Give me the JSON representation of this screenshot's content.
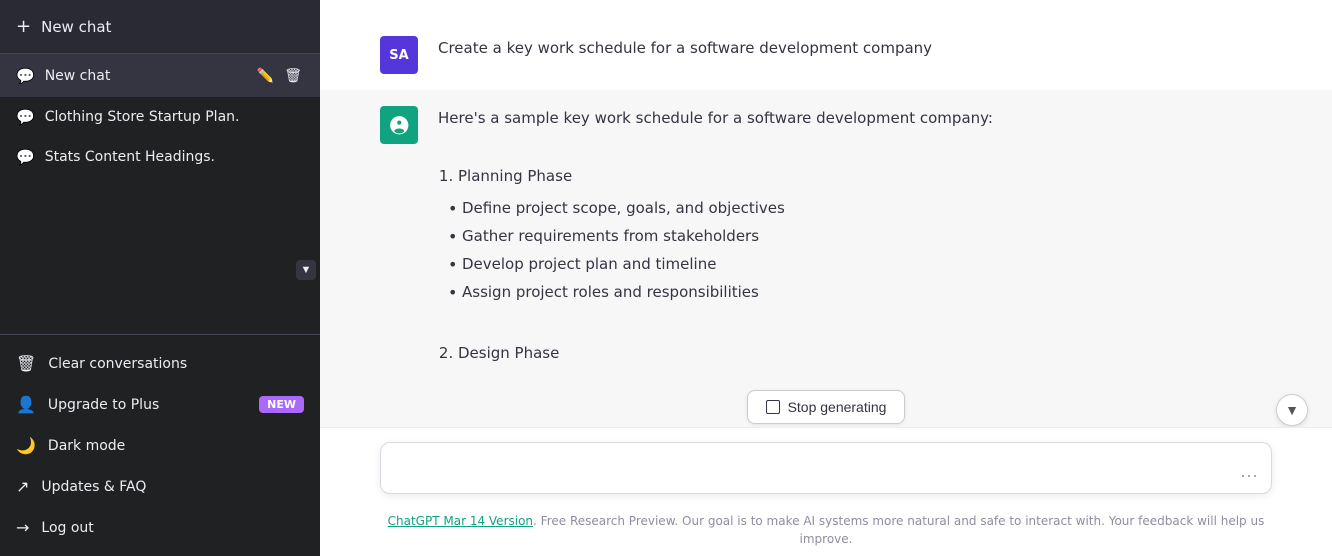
{
  "sidebar": {
    "new_chat_top_label": "New chat",
    "new_chat_top_icon": "+",
    "scroll_up_icon": "▲",
    "scroll_down_icon": "▼",
    "chats": [
      {
        "id": "active",
        "label": "New chat",
        "active": true
      },
      {
        "id": "clothing",
        "label": "Clothing Store Startup Plan.",
        "active": false
      },
      {
        "id": "stats",
        "label": "Stats Content Headings.",
        "active": false
      }
    ],
    "bottom_items": [
      {
        "id": "clear",
        "icon": "🗑",
        "label": "Clear conversations"
      },
      {
        "id": "upgrade",
        "icon": "👤",
        "label": "Upgrade to Plus",
        "badge": "NEW"
      },
      {
        "id": "darkmode",
        "icon": "🌙",
        "label": "Dark mode"
      },
      {
        "id": "updates",
        "icon": "↗",
        "label": "Updates & FAQ"
      },
      {
        "id": "logout",
        "icon": "→",
        "label": "Log out"
      }
    ]
  },
  "main": {
    "user_avatar_initials": "SA",
    "user_message": "Create a key work schedule for a software development company",
    "ai_intro": "Here's a sample key work schedule for a software development company:",
    "planning_phase_label": "Planning Phase",
    "planning_items": [
      "Define project scope, goals, and objectives",
      "Gather requirements from stakeholders",
      "Develop project plan and timeline",
      "Assign project roles and responsibilities"
    ],
    "design_phase_label": "Design Phase",
    "stop_generating_label": "Stop generating",
    "input_placeholder": "",
    "input_more_icon": "···"
  },
  "footer": {
    "link_text": "ChatGPT Mar 14 Version",
    "description": ". Free Research Preview. Our goal is to make AI systems more natural and safe to interact with. Your feedback will help us improve."
  }
}
